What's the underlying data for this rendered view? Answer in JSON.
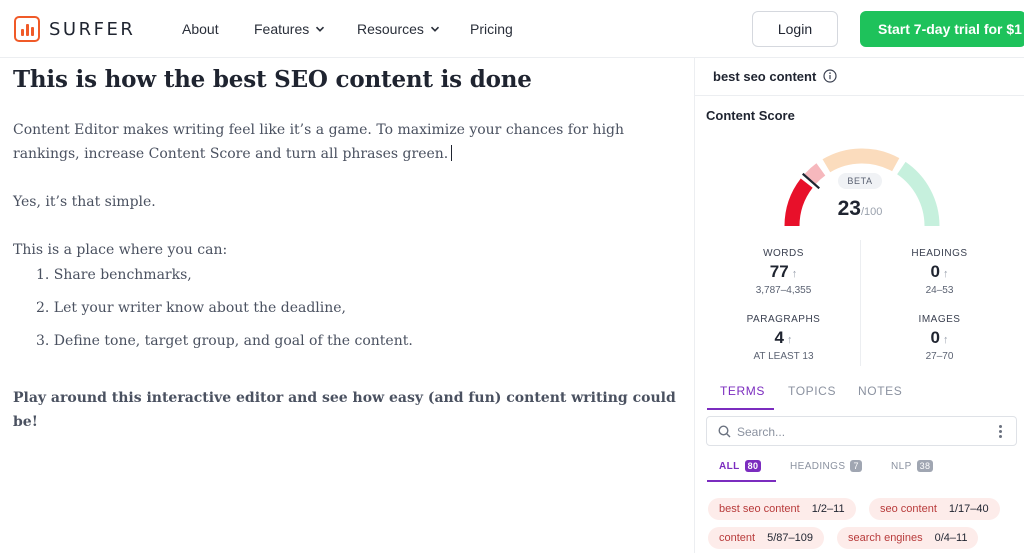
{
  "header": {
    "logo_text": "SURFER",
    "nav": {
      "about": "About",
      "features": "Features",
      "resources": "Resources",
      "pricing": "Pricing"
    },
    "login": "Login",
    "trial": "Start 7-day trial for $1"
  },
  "editor": {
    "title": "This is how the best SEO content is done",
    "paragraph1": "Content Editor makes writing feel like it’s a game. To maximize your chances for high rankings, increase Content Score and turn all phrases green.",
    "paragraph2": "Yes, it’s that simple.",
    "paragraph3": "This is a place where you can:",
    "list": [
      "1. Share benchmarks,",
      "2. Let your writer know about the deadline,",
      "3. Define tone, target group, and goal of the content."
    ],
    "closing": "Play around this interactive editor and see how easy (and fun) content writing could be!"
  },
  "sidebar": {
    "keyword": "best seo content",
    "content_score_title": "Content Score",
    "beta": "BETA",
    "score": "23",
    "score_max": "/100",
    "score_fraction": 0.23,
    "metrics": {
      "words": {
        "label": "WORDS",
        "value": "77",
        "range": "3,787–4,355"
      },
      "headings": {
        "label": "HEADINGS",
        "value": "0",
        "range": "24–53"
      },
      "paragraphs": {
        "label": "PARAGRAPHS",
        "value": "4",
        "range": "AT LEAST 13"
      },
      "images": {
        "label": "IMAGES",
        "value": "0",
        "range": "27–70"
      }
    },
    "tabs": {
      "terms": "TERMS",
      "topics": "TOPICS",
      "notes": "NOTES"
    },
    "search_placeholder": "Search...",
    "subtabs": {
      "all": {
        "label": "ALL",
        "count": "80"
      },
      "headings": {
        "label": "HEADINGS",
        "count": "7"
      },
      "nlp": {
        "label": "NLP",
        "count": "38"
      }
    },
    "terms": [
      {
        "term": "best seo content",
        "count": "1/2–11"
      },
      {
        "term": "seo content",
        "count": "1/17–40"
      },
      {
        "term": "content",
        "count": "5/87–109"
      },
      {
        "term": "search engines",
        "count": "0/4–11"
      }
    ]
  },
  "colors": {
    "accent_green": "#1ec25b",
    "accent_purple": "#7b2cbf",
    "gauge_red": "#e8102a",
    "gauge_pink": "#f6b8bd",
    "gauge_peach": "#fbdcbd",
    "gauge_mint": "#c6f0dd"
  }
}
